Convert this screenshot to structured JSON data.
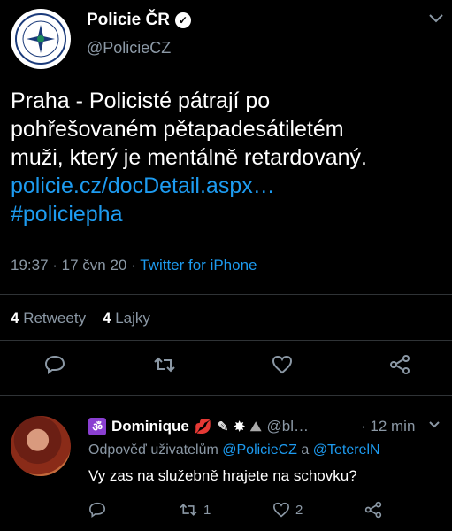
{
  "tweet": {
    "account_name": "Policie ČR",
    "handle": "@PolicieCZ",
    "text_lines": [
      "Praha - Policisté pátrají po",
      "pohřešovaném pětapadesátiletém",
      "muži, který je mentálně retardovaný."
    ],
    "link": "policie.cz/docDetail.aspx…",
    "hashtag": "#policiepha",
    "time": "19:37",
    "date": "17 čvn 20",
    "source": "Twitter for iPhone",
    "retweets_count": "4",
    "retweets_label": "Retweety",
    "likes_count": "4",
    "likes_label": "Lajky"
  },
  "reply": {
    "name": "Dominique",
    "handle": "@bl…",
    "time": "12 min",
    "replying_prefix": "Odpověď uživatelům",
    "replying_user1": "@PolicieCZ",
    "replying_and": "a",
    "replying_user2": "@TeterelN",
    "text": "Vy zas na služebně hrajete na schovku?",
    "retweets": "1",
    "likes": "2"
  },
  "icons": {
    "reply": "reply-icon",
    "retweet": "retweet-icon",
    "like": "heart-icon",
    "share": "share-icon",
    "verified": "verified-icon",
    "chevron": "chevron-down-icon"
  },
  "colors": {
    "link": "#1d9bf0",
    "muted": "#8b98a5",
    "background": "#000000"
  }
}
